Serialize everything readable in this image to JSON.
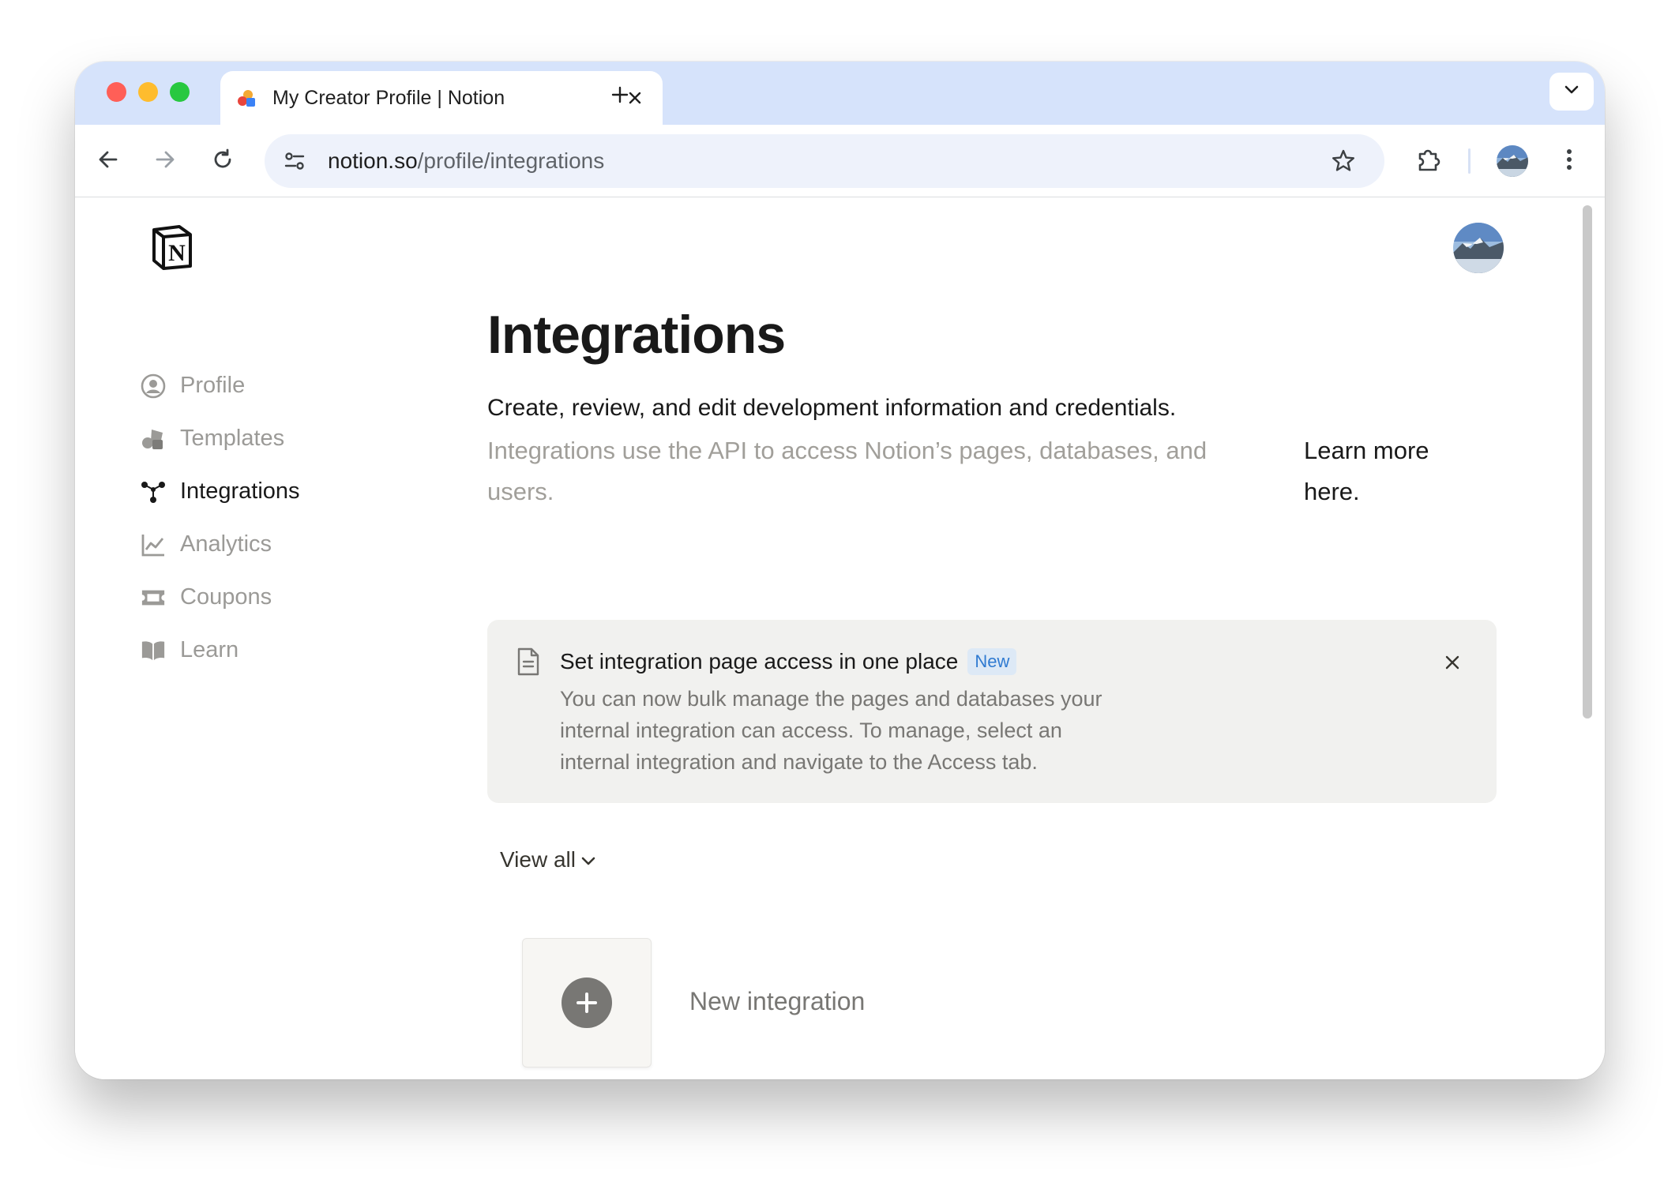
{
  "browser": {
    "tab_title": "My Creator Profile | Notion",
    "url_host": "notion.so",
    "url_path": "/profile/integrations"
  },
  "sidebar": {
    "items": [
      {
        "label": "Profile",
        "icon": "profile-icon",
        "active": false
      },
      {
        "label": "Templates",
        "icon": "templates-icon",
        "active": false
      },
      {
        "label": "Integrations",
        "icon": "integrations-icon",
        "active": true
      },
      {
        "label": "Analytics",
        "icon": "analytics-icon",
        "active": false
      },
      {
        "label": "Coupons",
        "icon": "coupons-icon",
        "active": false
      },
      {
        "label": "Learn",
        "icon": "learn-icon",
        "active": false
      }
    ]
  },
  "main": {
    "title": "Integrations",
    "subtitle": "Create, review, and edit development information and credentials.",
    "description": "Integrations use the API to access Notion’s pages, databases, and users.",
    "learn_more": "Learn more here.",
    "callout": {
      "title": "Set integration page access in one place",
      "badge": "New",
      "body": "You can now bulk manage the pages and databases your internal integration can access. To manage, select an internal integration and navigate to the Access tab."
    },
    "filter_label": "View all",
    "new_integration_label": "New integration"
  },
  "colors": {
    "tab_strip": "#d6e3fb",
    "badge_text": "#2f7ad1",
    "badge_bg": "#dde9f6",
    "muted_text": "#9b9a97"
  }
}
